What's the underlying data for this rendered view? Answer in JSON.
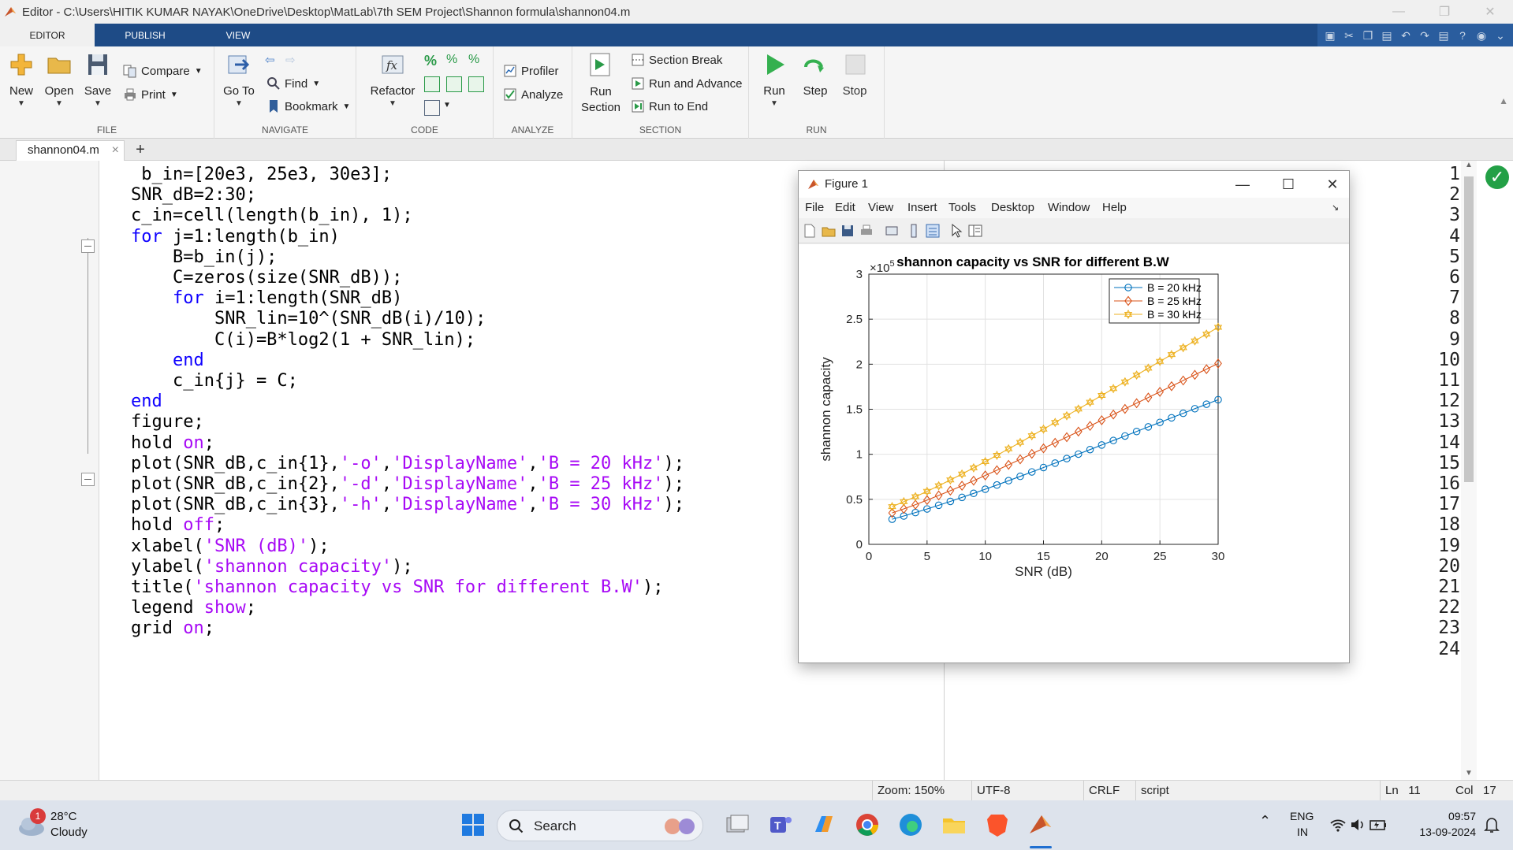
{
  "window": {
    "title": "Editor - C:\\Users\\HITIK KUMAR NAYAK\\OneDrive\\Desktop\\MatLab\\7th SEM Project\\Shannon formula\\shannon04.m"
  },
  "ribbon_tabs": [
    "EDITOR",
    "PUBLISH",
    "VIEW"
  ],
  "ribbon": {
    "file": {
      "label": "FILE",
      "new": "New",
      "open": "Open",
      "save": "Save",
      "compare": "Compare",
      "print": "Print"
    },
    "navigate": {
      "label": "NAVIGATE",
      "goto": "Go To",
      "find": "Find",
      "bookmark": "Bookmark"
    },
    "code": {
      "label": "CODE",
      "refactor": "Refactor"
    },
    "analyze": {
      "label": "ANALYZE",
      "profiler": "Profiler",
      "analyze": "Analyze"
    },
    "section": {
      "label": "SECTION",
      "run_section": "Run Section",
      "section_break": "Section Break",
      "run_advance": "Run and Advance",
      "run_to_end": "Run to End"
    },
    "run": {
      "label": "RUN",
      "run": "Run",
      "step": "Step",
      "stop": "Stop"
    }
  },
  "editor": {
    "tab": "shannon04.m",
    "line_numbers": [
      "1",
      "2",
      "3",
      "4",
      "5",
      "6",
      "7",
      "8",
      "9",
      "10",
      "11",
      "12",
      "13",
      "14",
      "15",
      "16",
      "17",
      "18",
      "19",
      "20",
      "21",
      "22",
      "23",
      "24"
    ],
    "lines": [
      [
        {
          "t": " b_in=[20e3, 25e3, 30e3];",
          "c": "n"
        }
      ],
      [
        {
          "t": "SNR_dB=2:30;",
          "c": "n"
        }
      ],
      [
        {
          "t": "c_in=cell(length(b_in), 1);",
          "c": "n"
        }
      ],
      [
        {
          "t": "for",
          "c": "kw"
        },
        {
          "t": " j=1:length(b_in)",
          "c": "n"
        }
      ],
      [
        {
          "t": "    B=b_in(j);",
          "c": "n"
        }
      ],
      [
        {
          "t": "    C=zeros(size(SNR_dB));",
          "c": "n"
        }
      ],
      [
        {
          "t": "    ",
          "c": "n"
        },
        {
          "t": "for",
          "c": "kw"
        },
        {
          "t": " i=1:length(SNR_dB)",
          "c": "n"
        }
      ],
      [
        {
          "t": "        SNR_lin=10^(SNR_dB(i)/10);",
          "c": "n"
        }
      ],
      [
        {
          "t": "        C(i)=B*log2(1 + SNR_lin);",
          "c": "n"
        }
      ],
      [
        {
          "t": "    ",
          "c": "n"
        },
        {
          "t": "end",
          "c": "kw"
        }
      ],
      [
        {
          "t": "    c_in{j} = C;",
          "c": "n"
        }
      ],
      [
        {
          "t": "end",
          "c": "kw"
        }
      ],
      [
        {
          "t": "figure;",
          "c": "n"
        }
      ],
      [
        {
          "t": "hold ",
          "c": "n"
        },
        {
          "t": "on",
          "c": "str"
        },
        {
          "t": ";",
          "c": "n"
        }
      ],
      [
        {
          "t": "plot(SNR_dB,c_in{1},",
          "c": "n"
        },
        {
          "t": "'-o'",
          "c": "str"
        },
        {
          "t": ",",
          "c": "n"
        },
        {
          "t": "'DisplayName'",
          "c": "str"
        },
        {
          "t": ",",
          "c": "n"
        },
        {
          "t": "'B = 20 kHz'",
          "c": "str"
        },
        {
          "t": ");",
          "c": "n"
        }
      ],
      [
        {
          "t": "plot(SNR_dB,c_in{2},",
          "c": "n"
        },
        {
          "t": "'-d'",
          "c": "str"
        },
        {
          "t": ",",
          "c": "n"
        },
        {
          "t": "'DisplayName'",
          "c": "str"
        },
        {
          "t": ",",
          "c": "n"
        },
        {
          "t": "'B = 25 kHz'",
          "c": "str"
        },
        {
          "t": ");",
          "c": "n"
        }
      ],
      [
        {
          "t": "plot(SNR_dB,c_in{3},",
          "c": "n"
        },
        {
          "t": "'-h'",
          "c": "str"
        },
        {
          "t": ",",
          "c": "n"
        },
        {
          "t": "'DisplayName'",
          "c": "str"
        },
        {
          "t": ",",
          "c": "n"
        },
        {
          "t": "'B = 30 kHz'",
          "c": "str"
        },
        {
          "t": ");",
          "c": "n"
        }
      ],
      [
        {
          "t": "hold ",
          "c": "n"
        },
        {
          "t": "off",
          "c": "str"
        },
        {
          "t": ";",
          "c": "n"
        }
      ],
      [
        {
          "t": "xlabel(",
          "c": "n"
        },
        {
          "t": "'SNR (dB)'",
          "c": "str"
        },
        {
          "t": ");",
          "c": "n"
        }
      ],
      [
        {
          "t": "ylabel(",
          "c": "n"
        },
        {
          "t": "'shannon capacity'",
          "c": "str"
        },
        {
          "t": ");",
          "c": "n"
        }
      ],
      [
        {
          "t": "title(",
          "c": "n"
        },
        {
          "t": "'shannon capacity vs SNR for different B.W'",
          "c": "str"
        },
        {
          "t": ");",
          "c": "n"
        }
      ],
      [
        {
          "t": "legend ",
          "c": "n"
        },
        {
          "t": "show",
          "c": "str"
        },
        {
          "t": ";",
          "c": "n"
        }
      ],
      [
        {
          "t": "grid ",
          "c": "n"
        },
        {
          "t": "on",
          "c": "str"
        },
        {
          "t": ";",
          "c": "n"
        }
      ],
      [
        {
          "t": "",
          "c": "n"
        }
      ]
    ]
  },
  "status": {
    "zoom": "Zoom: 150%",
    "encoding": "UTF-8",
    "eol": "CRLF",
    "type": "script",
    "ln_label": "Ln",
    "ln": "11",
    "col_label": "Col",
    "col": "17"
  },
  "figure": {
    "title": "Figure 1",
    "menu": [
      "File",
      "Edit",
      "View",
      "Insert",
      "Tools",
      "Desktop",
      "Window",
      "Help"
    ]
  },
  "chart_data": {
    "type": "line",
    "title": "shannon capacity vs SNR for different B.W",
    "xlabel": "SNR (dB)",
    "ylabel": "shannon capacity",
    "exponent_label": "×10",
    "exponent": "5",
    "xlim": [
      0,
      30
    ],
    "ylim": [
      0,
      300000
    ],
    "xticks": [
      "0",
      "5",
      "10",
      "15",
      "20",
      "25",
      "30"
    ],
    "yticks": [
      "0",
      "0.5",
      "1",
      "1.5",
      "2",
      "2.5",
      "3"
    ],
    "grid": true,
    "legend_position": "top-right",
    "x": [
      2,
      3,
      4,
      5,
      6,
      7,
      8,
      9,
      10,
      11,
      12,
      13,
      14,
      15,
      16,
      17,
      18,
      19,
      20,
      21,
      22,
      23,
      24,
      25,
      26,
      27,
      28,
      29,
      30
    ],
    "series": [
      {
        "name": "B = 20 kHz",
        "marker": "circle",
        "color": "#0072bd",
        "values": [
          27900,
          31500,
          35300,
          39300,
          43400,
          47700,
          52100,
          56600,
          61200,
          65900,
          70700,
          75500,
          80400,
          85300,
          90200,
          95200,
          100200,
          105200,
          110300,
          115300,
          120300,
          125300,
          130400,
          135400,
          140500,
          145500,
          150600,
          155600,
          160600
        ]
      },
      {
        "name": "B = 25 kHz",
        "marker": "diamond",
        "color": "#d95319",
        "values": [
          34900,
          39400,
          44100,
          49100,
          54300,
          59600,
          65100,
          70700,
          76500,
          82300,
          88300,
          94400,
          100500,
          106600,
          112800,
          119000,
          125200,
          131500,
          137800,
          144100,
          150400,
          156700,
          163000,
          169300,
          175600,
          181900,
          188200,
          194500,
          200800
        ]
      },
      {
        "name": "B = 30 kHz",
        "marker": "hexagram",
        "color": "#edb120",
        "values": [
          41900,
          47300,
          52900,
          58900,
          65100,
          71500,
          78100,
          84900,
          91800,
          98800,
          106000,
          113200,
          120600,
          127900,
          135400,
          142800,
          150300,
          157800,
          165300,
          172900,
          180400,
          188000,
          195600,
          203100,
          210700,
          218300,
          225900,
          233400,
          241000
        ]
      }
    ]
  },
  "taskbar": {
    "weather_badge": "1",
    "temp": "28°C",
    "condition": "Cloudy",
    "search": "Search",
    "lang": "ENG",
    "region": "IN",
    "time": "09:57",
    "date": "13-09-2024"
  }
}
